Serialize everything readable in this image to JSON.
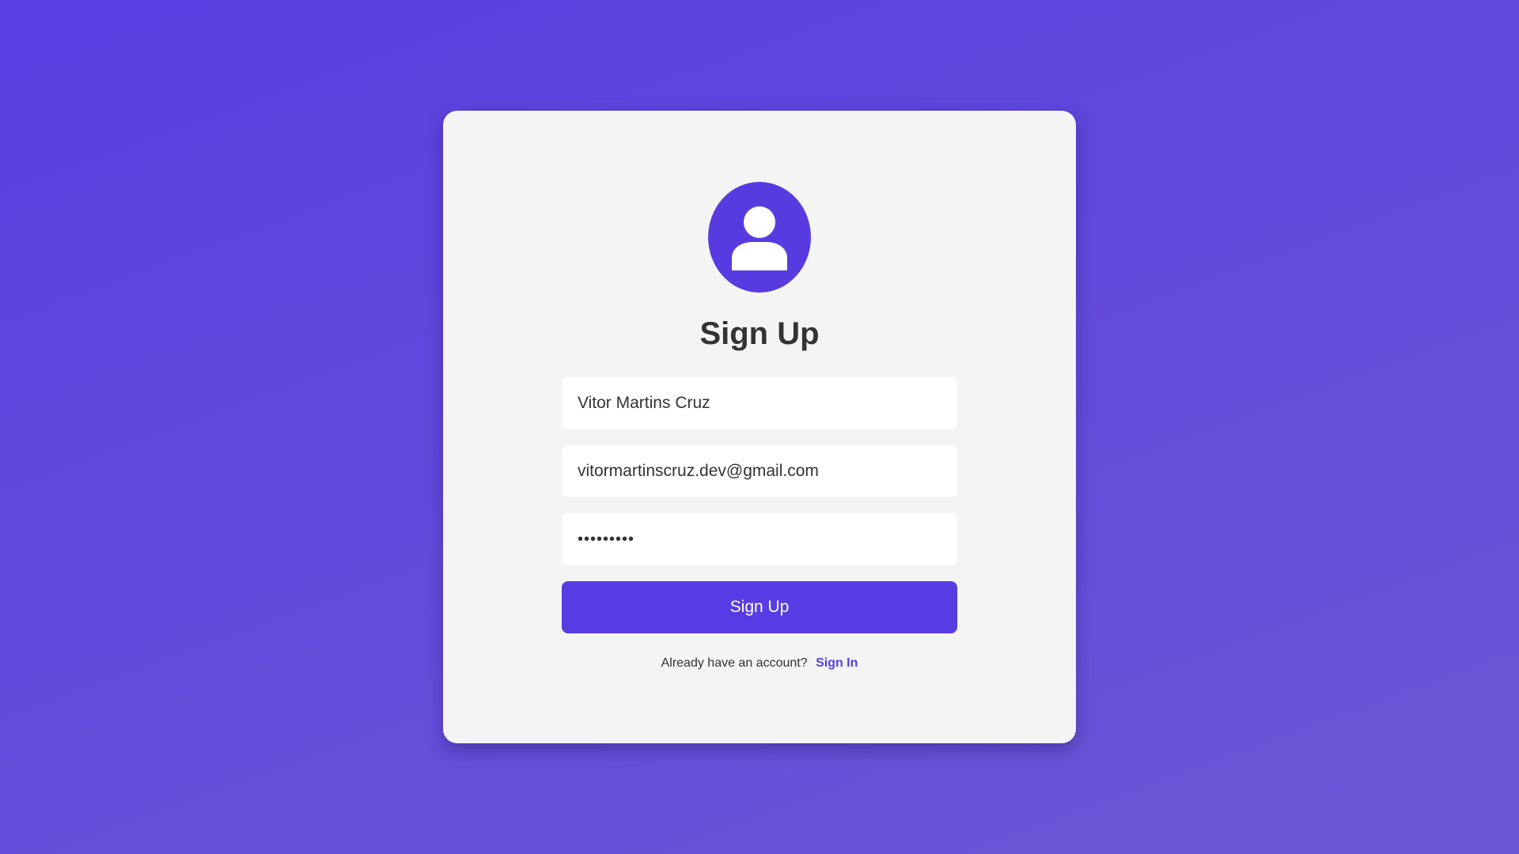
{
  "signup": {
    "avatar_icon": "user-icon",
    "title": "Sign Up",
    "name_value": "Vitor Martins Cruz",
    "email_value": "vitormartinscruz.dev@gmail.com",
    "password_value": "•••••••••",
    "submit_label": "Sign Up",
    "footer_text": "Already have an account?",
    "signin_link": "Sign In"
  },
  "colors": {
    "accent": "#573ce3",
    "background_start": "#5b3ee0",
    "background_end": "#6b57d4",
    "card": "#f4f4f5",
    "text": "#333333"
  }
}
